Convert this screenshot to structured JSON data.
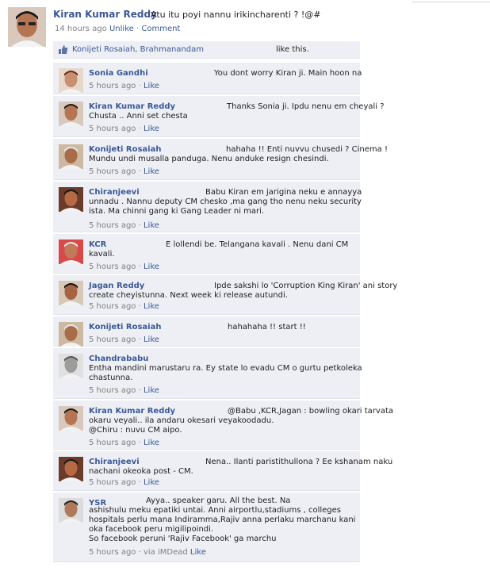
{
  "post": {
    "author": "Kiran Kumar Reddy",
    "text": "Atu itu poyi nannu irikincharenti ? !@#",
    "time": "14 hours ago",
    "unlike": "Unlike",
    "sep": "·",
    "comment": "Comment"
  },
  "likes": {
    "names": "Konijeti Rosaiah, Brahmanandam",
    "rest": "like this."
  },
  "comments": [
    {
      "author": "Sonia Gandhi",
      "lines": [
        "You dont worry Kiran ji. Main hoon na"
      ],
      "time": "5 hours ago",
      "like": "Like"
    },
    {
      "author": "Kiran Kumar Reddy",
      "lines": [
        "Thanks Sonia ji. Ipdu nenu em cheyali ?",
        "Chusta .. Anni set chesta"
      ],
      "time": "5 hours ago",
      "like": "Like"
    },
    {
      "author": "Konijeti Rosaiah",
      "lines": [
        "hahaha !! Enti nuvvu chusedi ? Cinema !",
        "Mundu undi musalla panduga. Nenu anduke resign chesindi."
      ],
      "time": "5 hours ago",
      "like": "Like"
    },
    {
      "author": "Chiranjeevi",
      "lines": [
        "Babu Kiran em jarigina neku e annayya",
        "unnadu . Nannu deputy CM chesko ,ma gang tho nenu neku security",
        "ista. Ma chinni gang ki Gang Leader ni mari."
      ],
      "time": "5 hours ago",
      "like": "Like"
    },
    {
      "author": "KCR",
      "lines": [
        "E lollendi be. Telangana kavali . Nenu dani CM",
        "kavali."
      ],
      "time": "5 hours ago",
      "like": "Like"
    },
    {
      "author": "Jagan Reddy",
      "lines": [
        "Ipde sakshi lo 'Corruption King Kiran' ani story",
        "create cheyistunna. Next week ki release autundi."
      ],
      "time": "5 hours ago",
      "like": "Like"
    },
    {
      "author": "Konijeti Rosaiah",
      "lines": [
        "hahahaha !! start !!"
      ],
      "time": "5 hours ago",
      "like": "Like"
    },
    {
      "author": "Chandrababu",
      "lines": [
        "Entha mandini marustaru ra. Ey state lo evadu CM o gurtu petkoleka",
        "chastunna."
      ],
      "time": "5 hours ago",
      "like": "Like"
    },
    {
      "author": "Kiran Kumar Reddy",
      "lines": [
        "@Babu ,KCR,Jagan : bowling okari tarvata",
        "okaru veyali.. ila andaru okesari veyakoodadu.",
        "@Chiru : nuvu CM aipo."
      ],
      "time": "5 hours ago",
      "like": "Like"
    },
    {
      "author": "Chiranjeevi",
      "lines": [
        "Nena.. Ilanti paristithullona ? Ee kshanam naku",
        "nachani okeoka post - CM."
      ],
      "time": "5 hours ago",
      "like": "Like"
    },
    {
      "author": "YSR",
      "lines": [
        "Ayya.. speaker garu. All the best. Na",
        "ashishulu meku epatiki untai. Anni airportlu,stadiums , colleges",
        "hospitals perlu mana Indiramma,Rajiv anna perlaku marchanu kani",
        "oka facebook peru migilipoindi.",
        "So facebook peruni 'Rajiv Facebook' ga marchu"
      ],
      "time": "5 hours ago",
      "via": "via iMDead",
      "like": "Like"
    }
  ],
  "colors": {
    "link": "#3b5998",
    "comment_bg": "#edeff4",
    "meta": "#808080"
  }
}
